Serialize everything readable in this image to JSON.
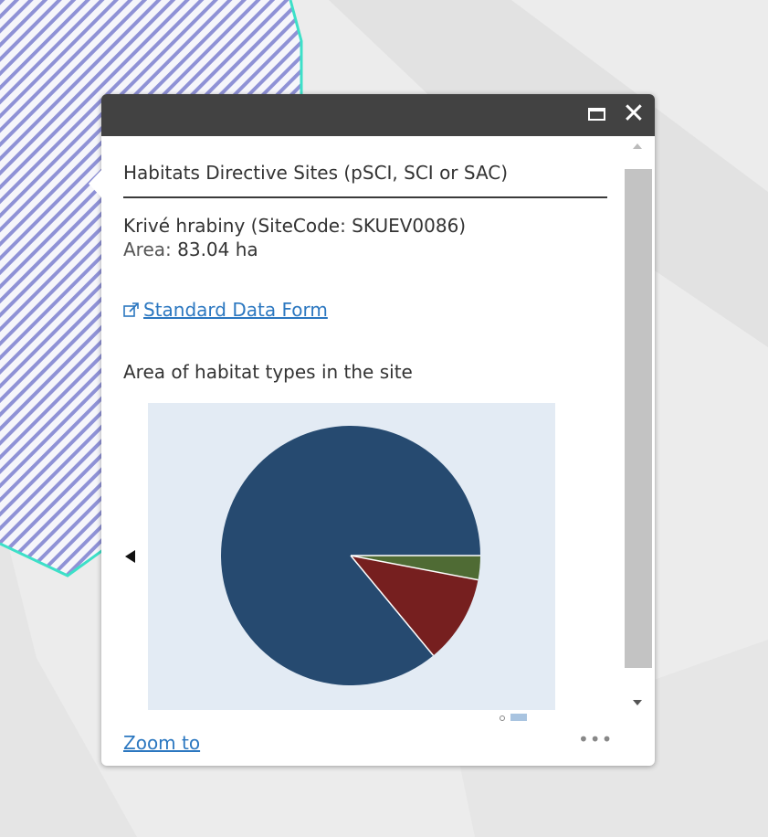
{
  "popup": {
    "title": "Habitats Directive Sites (pSCI, SCI or SAC)",
    "site_name": "Krivé hrabiny",
    "site_code_text": "(SiteCode: SKUEV0086)",
    "area_label": "Area:",
    "area_value": "83.04 ha",
    "link_label": "Standard Data Form",
    "chart_title": "Area of habitat types in the site",
    "zoom_label": "Zoom to",
    "more_label": "•••",
    "close_label": "✕"
  },
  "icons": {
    "maximize": "maximize-icon",
    "close": "close-icon",
    "external_link": "external-link-icon",
    "previous": "chevron-left-icon",
    "more": "more-icon"
  },
  "colors": {
    "titlebar": "#424242",
    "link": "#2b77c0",
    "chart_background": "#e3ebf4",
    "map_hatch": "#8f92d6",
    "map_boundary": "#3de0c8"
  },
  "chart_data": {
    "type": "pie",
    "title": "Area of habitat types in the site",
    "slices": [
      {
        "value": 86,
        "color": "#264a70"
      },
      {
        "value": 11,
        "color": "#761f1f"
      },
      {
        "value": 3,
        "color": "#4f6b34"
      }
    ]
  }
}
